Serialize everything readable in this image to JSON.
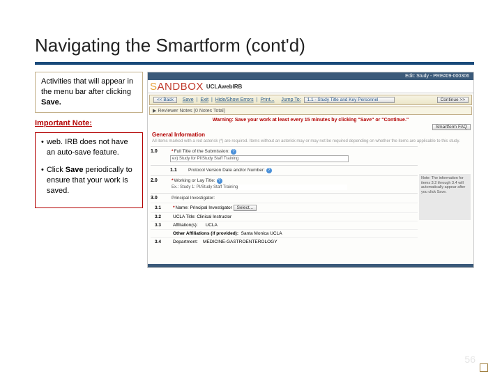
{
  "title": "Navigating the Smartform (cont'd)",
  "left": {
    "intro": "Activities that will appear in the menu bar after clicking ",
    "intro_bold": "Save.",
    "important": "Important Note:",
    "b1": "web. IRB does not have an auto-save feature.",
    "b2a": "Click ",
    "b2bold": "Save",
    "b2b": " periodically to ensure that your work is saved."
  },
  "shot": {
    "edit": "Edit: Study - PRE#09-000306",
    "sandbox": "SANDBOX",
    "ucla": "UCLAwebIRB",
    "back": "<< Back",
    "menu_save": "Save",
    "menu_exit": "Exit",
    "menu_hide": "Hide/Show Errors",
    "menu_print": "Print...",
    "menu_jump": "Jump To:",
    "jump_val": "1.1 - Study Title and Key Personnel",
    "cont": "Continue >>",
    "reviewer": "Reviewer Notes (0 Notes Total)",
    "warning": "Warning: Save your work at least every 15 minutes by clicking \"Save\" or \"Continue.\"",
    "faq": "Smartform FAQ",
    "section": "General Information",
    "instr": "All items marked with a red asterisk (*) are required. Items without an asterisk may or may not be required depending on whether the items are applicable to this study.",
    "q10": "Full Title of the Submission:",
    "q10_val": "ex) Study for PI/Study Staff Training",
    "q11": "Protocol Version Date and/or Number:",
    "q20": "Working or Lay Title:",
    "q20_val": "Ex.: Study 1: PI/Study Staff Training",
    "sidenote": "Note: The information for items 3.2 through 3.4 will automatically appear after you click Save.",
    "q30": "Principal Investigator:",
    "q31": "Name:  Principal Investigator",
    "q31_btn": "Select...",
    "q32": "UCLA Title:  Clinical Instructor",
    "q33a": "Affiliation(s):",
    "q33a_val": "UCLA",
    "q33b": "Other Affiliations (if provided):",
    "q33b_val": "Santa Monica UCLA",
    "q34": "Department:",
    "q34_val": "MEDICINE-GASTROENTEROLOGY"
  },
  "page": "56"
}
